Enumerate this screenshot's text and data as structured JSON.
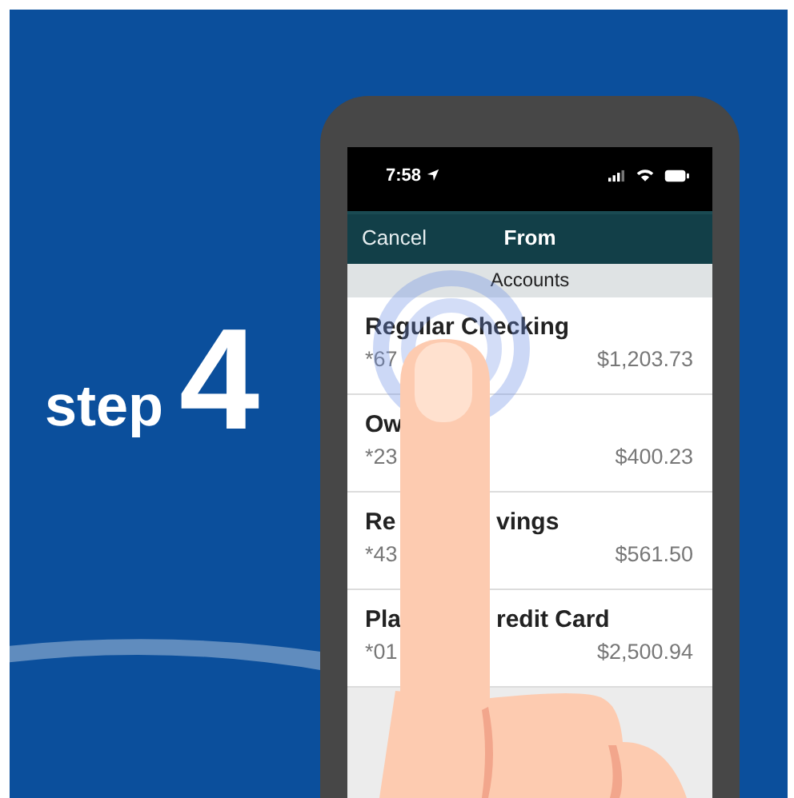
{
  "step_label": {
    "word": "step",
    "number": "4"
  },
  "status_bar": {
    "time": "7:58"
  },
  "nav": {
    "cancel": "Cancel",
    "title": "From"
  },
  "section": "Accounts",
  "accounts": [
    {
      "name_parts": [
        "Regular Checking"
      ],
      "number": "*67",
      "balance": "$1,203.73"
    },
    {
      "name_parts": [
        "Ow"
      ],
      "number": "*23",
      "balance": "$400.23"
    },
    {
      "name_parts": [
        "Re",
        "vings"
      ],
      "number": "*43",
      "balance": "$561.50"
    },
    {
      "name_parts": [
        "Pla",
        "redit Card"
      ],
      "number": "*01",
      "balance": "$2,500.94"
    }
  ]
}
